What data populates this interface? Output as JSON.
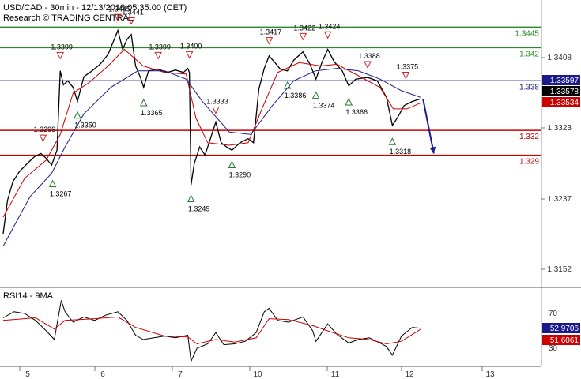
{
  "header": {
    "symbol_line": "USD/CAD - 30min - 12/13/2018 05:35:00 (CET)",
    "provider": "Research © TRADING CENTRAL"
  },
  "colors": {
    "price": "#000000",
    "ma_fast": "#cc0000",
    "ma_slow": "#1a1a8c",
    "resistance": "#2a8a2a",
    "pivot": "#1a1a8c",
    "support": "#cc0000",
    "arrow": "#1a1a8c",
    "down_marker": "#cc2222",
    "up_marker": "#2a7a2a",
    "current_box": "#000000",
    "ma_box": "#cc0000",
    "rsi_box": "#1a1a8c"
  },
  "chart_data": [
    {
      "type": "line",
      "panel": "price",
      "title": "USD/CAD - 30min - 12/13/2018 05:35:00 (CET)",
      "x_tick_labels": [
        "5",
        "6",
        "7",
        "10",
        "11",
        "12",
        "13"
      ],
      "y_tick_labels": [
        "1.3408",
        "1.3323",
        "1.3237",
        "1.3152"
      ],
      "ylim": [
        1.31,
        1.348
      ],
      "grid": false,
      "levels": [
        {
          "label": "1.3445",
          "value": 1.3445,
          "role": "resistance"
        },
        {
          "label": "1.342",
          "value": 1.342,
          "role": "resistance"
        },
        {
          "label": "1.338",
          "value": 1.338,
          "role": "pivot"
        },
        {
          "label": "1.332",
          "value": 1.332,
          "role": "support"
        },
        {
          "label": "1.329",
          "value": 1.329,
          "role": "support"
        }
      ],
      "current_values": [
        {
          "label": "1.33597",
          "role": "ma_slow"
        },
        {
          "label": "1.33578",
          "role": "price"
        },
        {
          "label": "1.33534",
          "role": "ma_fast"
        }
      ],
      "markers": [
        {
          "label": "1.3299",
          "value": 1.3299,
          "t": 0.074,
          "dir": "down"
        },
        {
          "label": "1.3267",
          "value": 1.3267,
          "t": 0.092,
          "dir": "up"
        },
        {
          "label": "1.3399",
          "value": 1.3399,
          "t": 0.106,
          "dir": "down"
        },
        {
          "label": "1.3350",
          "value": 1.335,
          "t": 0.138,
          "dir": "up"
        },
        {
          "label": "1.3445",
          "value": 1.3445,
          "t": 0.213,
          "dir": "down"
        },
        {
          "label": "1.3441",
          "value": 1.3441,
          "t": 0.238,
          "dir": "down"
        },
        {
          "label": "1.3365",
          "value": 1.3365,
          "t": 0.261,
          "dir": "up"
        },
        {
          "label": "1.3399",
          "value": 1.3399,
          "t": 0.288,
          "dir": "down"
        },
        {
          "label": "1.3400",
          "value": 1.34,
          "t": 0.346,
          "dir": "down"
        },
        {
          "label": "1.3249",
          "value": 1.3249,
          "t": 0.349,
          "dir": "up"
        },
        {
          "label": "1.3333",
          "value": 1.3333,
          "t": 0.395,
          "dir": "down"
        },
        {
          "label": "1.3290",
          "value": 1.329,
          "t": 0.425,
          "dir": "up"
        },
        {
          "label": "1.3417",
          "value": 1.3417,
          "t": 0.494,
          "dir": "down"
        },
        {
          "label": "1.3386",
          "value": 1.3386,
          "t": 0.528,
          "dir": "up"
        },
        {
          "label": "1.3422",
          "value": 1.3422,
          "t": 0.557,
          "dir": "down"
        },
        {
          "label": "1.3374",
          "value": 1.3374,
          "t": 0.581,
          "dir": "up"
        },
        {
          "label": "1.3424",
          "value": 1.3424,
          "t": 0.603,
          "dir": "down"
        },
        {
          "label": "1.3366",
          "value": 1.3366,
          "t": 0.642,
          "dir": "up"
        },
        {
          "label": "1.3388",
          "value": 1.3388,
          "t": 0.677,
          "dir": "down"
        },
        {
          "label": "1.3318",
          "value": 1.3318,
          "t": 0.723,
          "dir": "up"
        },
        {
          "label": "1.3375",
          "value": 1.3375,
          "t": 0.748,
          "dir": "down"
        }
      ],
      "series": [
        {
          "role": "price",
          "points": [
            [
              0.0,
              1.3195
            ],
            [
              0.008,
              1.3235
            ],
            [
              0.018,
              1.3258
            ],
            [
              0.03,
              1.327
            ],
            [
              0.045,
              1.328
            ],
            [
              0.058,
              1.3288
            ],
            [
              0.07,
              1.3292
            ],
            [
              0.08,
              1.3286
            ],
            [
              0.09,
              1.3278
            ],
            [
              0.1,
              1.3296
            ],
            [
              0.106,
              1.3392
            ],
            [
              0.112,
              1.3375
            ],
            [
              0.12,
              1.338
            ],
            [
              0.13,
              1.3372
            ],
            [
              0.138,
              1.3355
            ],
            [
              0.15,
              1.3385
            ],
            [
              0.165,
              1.3392
            ],
            [
              0.18,
              1.34
            ],
            [
              0.195,
              1.3412
            ],
            [
              0.205,
              1.3428
            ],
            [
              0.213,
              1.3441
            ],
            [
              0.222,
              1.3418
            ],
            [
              0.23,
              1.343
            ],
            [
              0.238,
              1.3436
            ],
            [
              0.246,
              1.3398
            ],
            [
              0.255,
              1.3384
            ],
            [
              0.261,
              1.3372
            ],
            [
              0.27,
              1.3392
            ],
            [
              0.288,
              1.3394
            ],
            [
              0.305,
              1.339
            ],
            [
              0.32,
              1.3393
            ],
            [
              0.335,
              1.339
            ],
            [
              0.343,
              1.3395
            ],
            [
              0.346,
              1.339
            ],
            [
              0.349,
              1.3254
            ],
            [
              0.355,
              1.328
            ],
            [
              0.365,
              1.33
            ],
            [
              0.375,
              1.329
            ],
            [
              0.385,
              1.331
            ],
            [
              0.395,
              1.333
            ],
            [
              0.405,
              1.3305
            ],
            [
              0.415,
              1.33
            ],
            [
              0.425,
              1.3296
            ],
            [
              0.44,
              1.3305
            ],
            [
              0.455,
              1.331
            ],
            [
              0.465,
              1.3305
            ],
            [
              0.475,
              1.337
            ],
            [
              0.485,
              1.3395
            ],
            [
              0.494,
              1.341
            ],
            [
              0.505,
              1.3402
            ],
            [
              0.515,
              1.3394
            ],
            [
              0.528,
              1.3392
            ],
            [
              0.54,
              1.3405
            ],
            [
              0.557,
              1.3415
            ],
            [
              0.57,
              1.34
            ],
            [
              0.581,
              1.3382
            ],
            [
              0.592,
              1.3402
            ],
            [
              0.603,
              1.3418
            ],
            [
              0.615,
              1.3403
            ],
            [
              0.63,
              1.3392
            ],
            [
              0.642,
              1.3374
            ],
            [
              0.655,
              1.3382
            ],
            [
              0.677,
              1.3384
            ],
            [
              0.695,
              1.338
            ],
            [
              0.712,
              1.336
            ],
            [
              0.723,
              1.3326
            ],
            [
              0.733,
              1.3336
            ],
            [
              0.745,
              1.335
            ],
            [
              0.76,
              1.3355
            ],
            [
              0.775,
              1.3358
            ]
          ]
        },
        {
          "role": "ma_fast",
          "points": [
            [
              0.0,
              1.3215
            ],
            [
              0.04,
              1.3262
            ],
            [
              0.08,
              1.3284
            ],
            [
              0.106,
              1.3315
            ],
            [
              0.13,
              1.3365
            ],
            [
              0.16,
              1.3378
            ],
            [
              0.195,
              1.3398
            ],
            [
              0.225,
              1.3418
            ],
            [
              0.26,
              1.3398
            ],
            [
              0.3,
              1.339
            ],
            [
              0.34,
              1.3388
            ],
            [
              0.358,
              1.3335
            ],
            [
              0.38,
              1.3305
            ],
            [
              0.42,
              1.3302
            ],
            [
              0.455,
              1.3305
            ],
            [
              0.48,
              1.3345
            ],
            [
              0.51,
              1.339
            ],
            [
              0.55,
              1.3402
            ],
            [
              0.59,
              1.3398
            ],
            [
              0.62,
              1.34
            ],
            [
              0.66,
              1.3386
            ],
            [
              0.7,
              1.3372
            ],
            [
              0.725,
              1.3346
            ],
            [
              0.75,
              1.3346
            ],
            [
              0.775,
              1.3353
            ]
          ]
        },
        {
          "role": "ma_slow",
          "points": [
            [
              0.0,
              1.318
            ],
            [
              0.05,
              1.324
            ],
            [
              0.09,
              1.3268
            ],
            [
              0.115,
              1.33
            ],
            [
              0.15,
              1.334
            ],
            [
              0.2,
              1.3372
            ],
            [
              0.25,
              1.3392
            ],
            [
              0.3,
              1.3392
            ],
            [
              0.34,
              1.3382
            ],
            [
              0.37,
              1.3355
            ],
            [
              0.42,
              1.3318
            ],
            [
              0.46,
              1.3315
            ],
            [
              0.5,
              1.335
            ],
            [
              0.54,
              1.338
            ],
            [
              0.58,
              1.3392
            ],
            [
              0.62,
              1.3395
            ],
            [
              0.66,
              1.3392
            ],
            [
              0.7,
              1.3382
            ],
            [
              0.74,
              1.3368
            ],
            [
              0.775,
              1.336
            ]
          ]
        }
      ],
      "forecast_arrow": {
        "from": [
          0.78,
          1.3358
        ],
        "to": [
          0.8,
          1.3292
        ]
      }
    },
    {
      "type": "line",
      "panel": "rsi",
      "title": "RSI14 - 9MA",
      "y_tick_labels": [
        "70",
        "30"
      ],
      "ylim": [
        10,
        90
      ],
      "current_values": [
        {
          "label": "52.9706",
          "role": "rsi"
        },
        {
          "label": "51.6061",
          "role": "ma"
        }
      ],
      "series": [
        {
          "role": "rsi",
          "points": [
            [
              0.0,
              65
            ],
            [
              0.02,
              72
            ],
            [
              0.04,
              70
            ],
            [
              0.06,
              62
            ],
            [
              0.08,
              50
            ],
            [
              0.095,
              40
            ],
            [
              0.108,
              85
            ],
            [
              0.115,
              72
            ],
            [
              0.13,
              60
            ],
            [
              0.15,
              66
            ],
            [
              0.17,
              62
            ],
            [
              0.19,
              68
            ],
            [
              0.213,
              72
            ],
            [
              0.23,
              62
            ],
            [
              0.246,
              45
            ],
            [
              0.26,
              40
            ],
            [
              0.28,
              42
            ],
            [
              0.3,
              44
            ],
            [
              0.32,
              42
            ],
            [
              0.343,
              45
            ],
            [
              0.349,
              15
            ],
            [
              0.36,
              30
            ],
            [
              0.38,
              35
            ],
            [
              0.395,
              48
            ],
            [
              0.41,
              34
            ],
            [
              0.43,
              35
            ],
            [
              0.45,
              38
            ],
            [
              0.47,
              48
            ],
            [
              0.485,
              72
            ],
            [
              0.494,
              76
            ],
            [
              0.51,
              62
            ],
            [
              0.53,
              60
            ],
            [
              0.557,
              66
            ],
            [
              0.575,
              50
            ],
            [
              0.581,
              38
            ],
            [
              0.603,
              58
            ],
            [
              0.62,
              46
            ],
            [
              0.642,
              36
            ],
            [
              0.66,
              40
            ],
            [
              0.68,
              42
            ],
            [
              0.7,
              36
            ],
            [
              0.712,
              32
            ],
            [
              0.723,
              22
            ],
            [
              0.74,
              44
            ],
            [
              0.76,
              54
            ],
            [
              0.775,
              53
            ]
          ]
        },
        {
          "role": "ma",
          "points": [
            [
              0.0,
              62
            ],
            [
              0.06,
              65
            ],
            [
              0.095,
              52
            ],
            [
              0.115,
              62
            ],
            [
              0.17,
              64
            ],
            [
              0.213,
              66
            ],
            [
              0.246,
              54
            ],
            [
              0.3,
              44
            ],
            [
              0.343,
              43
            ],
            [
              0.36,
              35
            ],
            [
              0.395,
              40
            ],
            [
              0.43,
              37
            ],
            [
              0.47,
              42
            ],
            [
              0.494,
              64
            ],
            [
              0.53,
              63
            ],
            [
              0.575,
              56
            ],
            [
              0.603,
              50
            ],
            [
              0.642,
              42
            ],
            [
              0.68,
              40
            ],
            [
              0.712,
              35
            ],
            [
              0.74,
              38
            ],
            [
              0.775,
              51.6
            ]
          ]
        }
      ]
    }
  ]
}
